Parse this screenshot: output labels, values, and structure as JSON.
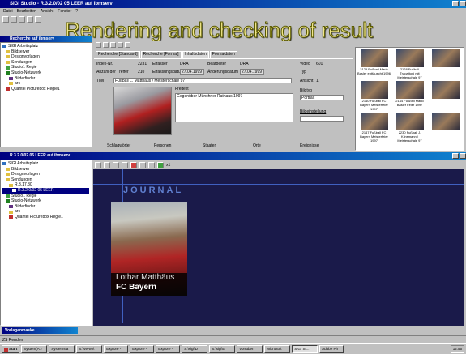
{
  "overlay_title": "Rendering and checking of result",
  "app_window": {
    "title": "SIGI Studio - R.3.2.0/02 05 LEER auf ibmserv",
    "menu": [
      "Datei",
      "Bearbeiten",
      "Ansicht",
      "Fenster",
      "?"
    ]
  },
  "top_pane": {
    "title": "Recherche auf ibmserv",
    "tree": [
      {
        "label": "SIGI Arbeitsplatz",
        "icon": "computer-icon"
      },
      {
        "label": "Bildserver",
        "icon": "folder-icon"
      },
      {
        "label": "Designvorlagen",
        "icon": "folder-icon"
      },
      {
        "label": "Sendungen",
        "icon": "folder-icon"
      },
      {
        "label": "Studio1 Regie",
        "icon": "folder-icon"
      },
      {
        "label": "Studio-Netzwerk",
        "icon": "network-icon"
      },
      {
        "label": "Bilderfinder",
        "icon": "search-icon"
      },
      {
        "label": "arc",
        "icon": "folder-icon"
      },
      {
        "label": "Quantel Picturebox Regie1",
        "icon": "device-icon"
      }
    ],
    "tabs": [
      "Recherche [Standard]",
      "Recherche [Formal]",
      "Inhaltsdaten",
      "Formaldaten"
    ],
    "fields": {
      "index_label": "Index-Nr.",
      "index_value": "2231",
      "erfasser_label": "Erfasser",
      "erfasser_value": "DRA",
      "bearbeiter_label": "Bearbeiter",
      "bearbeiter_value": "DRA",
      "video_label": "Video",
      "video_value": "601",
      "anzahl_label": "Anzahl der Treffer",
      "anzahl_value": "210",
      "erfassungsdatum_label": "Erfassungsdatum",
      "erfassungsdatum_value": "27.04.1999",
      "aenderungsdatum_label": "Änderungsdatum",
      "aenderungsdatum_value": "27.04.1999",
      "typ_label": "Typ",
      "ansicht_label": "Ansicht",
      "ansicht_value": "1",
      "titel_label": "Titel",
      "titel_value": "Fußball L. Matthäus / Meisterschale 97",
      "freitext_label": "Freitext",
      "freitext_value": "Gegenüber Münchner Rathaus 1997",
      "bildtyp_label": "Bildtyp",
      "bildtyp_value": "Portrait",
      "bildeinstellung_label": "Bildeinstellung"
    },
    "bottom_labels": [
      "Schlagwörter",
      "Personen",
      "Staaten",
      "Orte",
      "Ereignisse"
    ]
  },
  "thumbnails": [
    {
      "caption": "2125 Fußball Mario Basler enttäuscht 1996"
    },
    {
      "caption": "2128 Fußball Trapattoni mit Meisterschale 97"
    },
    {
      "caption": ""
    },
    {
      "caption": "2140 Fußball FC Bayern Meisterfeier 1997"
    },
    {
      "caption": "2144 Fußball Mario Basler Feier 1997"
    },
    {
      "caption": ""
    },
    {
      "caption": "2147 Fußball FC Bayern Meisterfeier 1997"
    },
    {
      "caption": "2230 Fußball J. Klinsmann / Meisterschale 97"
    },
    {
      "caption": ""
    }
  ],
  "bottom_window": {
    "title": "R.3.2.0/02 05 LEER auf ibmserv",
    "tree": [
      {
        "label": "SIGI Arbeitsplatz",
        "icon": "computer-icon"
      },
      {
        "label": "Bildserver",
        "icon": "folder-icon"
      },
      {
        "label": "Designvorlagen",
        "icon": "folder-icon"
      },
      {
        "label": "Sendungen",
        "icon": "folder-icon"
      },
      {
        "label": "R.3.17.30",
        "icon": "folder-icon"
      },
      {
        "label": "R.3.2.0/02 05 LEER",
        "icon": "document-icon"
      },
      {
        "label": "Studio1 Regie",
        "icon": "folder-icon"
      },
      {
        "label": "Studio-Netzwerk",
        "icon": "network-icon"
      },
      {
        "label": "Bilderfinder",
        "icon": "search-icon"
      },
      {
        "label": "arc",
        "icon": "folder-icon"
      },
      {
        "label": "Quantel Picturebox Regie1",
        "icon": "device-icon"
      }
    ],
    "zoom": "x1",
    "canvas": {
      "heading": "JOURNAL",
      "caption_name": "Lothar Matthäus",
      "caption_club": "FC Bayern"
    }
  },
  "status_bar": {
    "text": "ZS Renden"
  },
  "task_minimized": "Vorlagenmaske",
  "taskbar": {
    "start_label": "Start",
    "buttons": [
      "System(A:)",
      "Systemsta",
      "S:\\VeRM\\",
      "Explore -",
      "Explore -",
      "Explore -",
      "S:\\sigi\\D",
      "S:\\sigi\\S",
      "Vorrüber!",
      "Microsoft",
      "SIGI St...",
      "Adobe Ph"
    ],
    "active_index": 10,
    "clock": "12:55"
  },
  "colors": {
    "titlebar": "#000080",
    "canvas_bg": "#1a1a4a",
    "overlay_text": "#f0e68c",
    "caption_bar": "#000000"
  }
}
